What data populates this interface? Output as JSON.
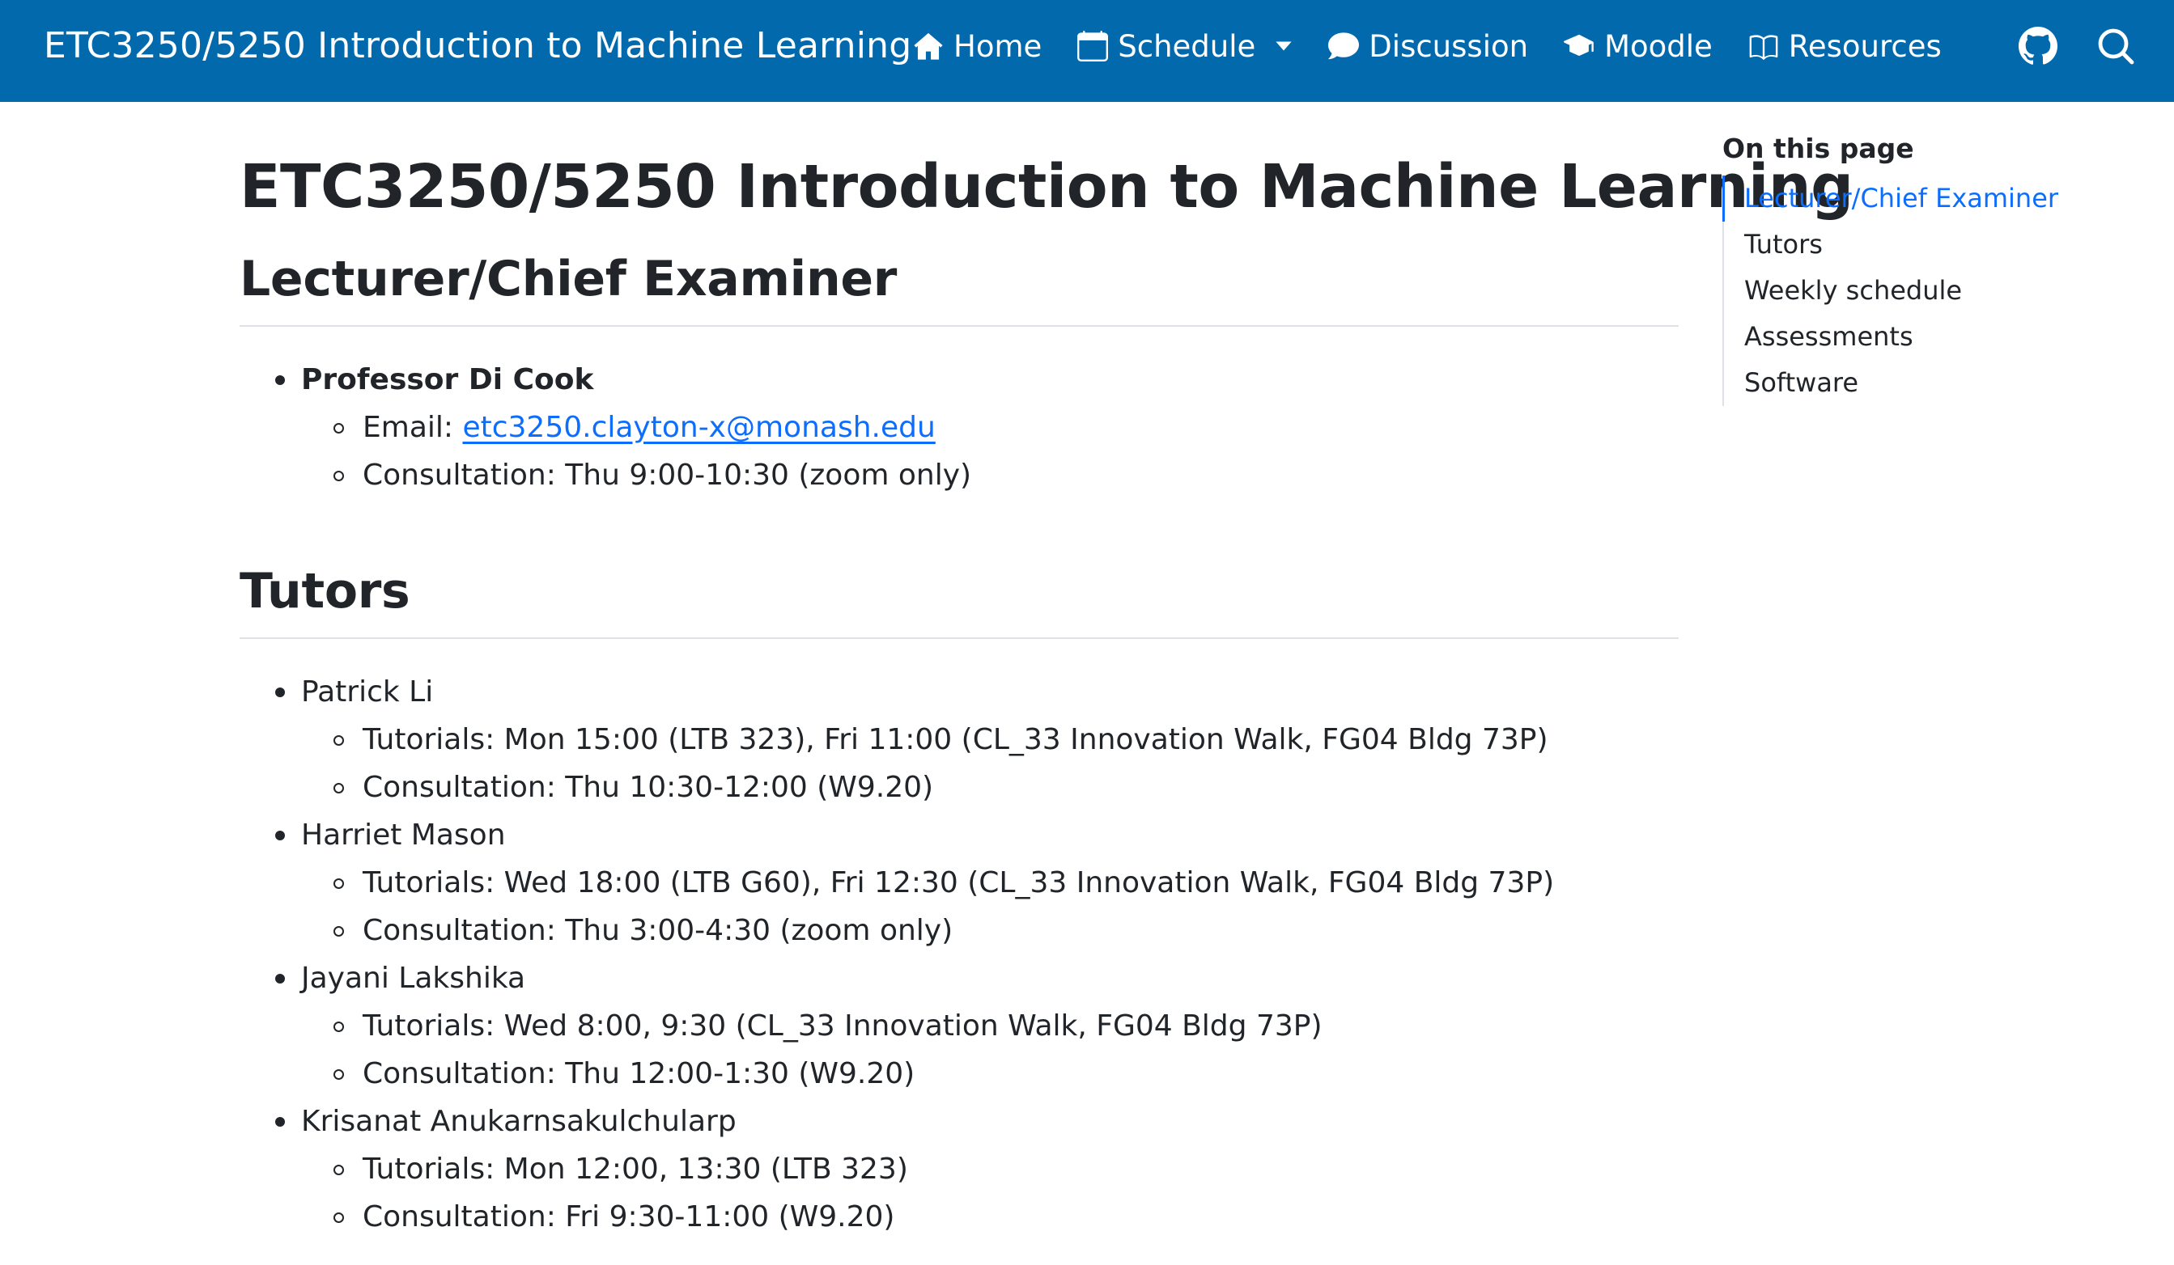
{
  "navbar": {
    "brand": "ETC3250/5250 Introduction to Machine Learning",
    "links": [
      {
        "label": "Home",
        "icon": "house-icon"
      },
      {
        "label": "Schedule",
        "icon": "calendar-icon",
        "dropdown": true
      },
      {
        "label": "Discussion",
        "icon": "chat-bubble-icon"
      },
      {
        "label": "Moodle",
        "icon": "mortarboard-icon"
      },
      {
        "label": "Resources",
        "icon": "open-book-icon"
      }
    ],
    "right_icons": [
      "github-icon",
      "search-icon"
    ],
    "background": "#0369ad"
  },
  "main": {
    "title": "ETC3250/5250 Introduction to Machine Learning",
    "lecturer_section": {
      "heading": "Lecturer/Chief Examiner",
      "name": "Professor Di Cook",
      "email_label": "Email: ",
      "email": "etc3250.clayton-x@monash.edu",
      "consultation": "Consultation: Thu 9:00-10:30 (zoom only)"
    },
    "tutors_section": {
      "heading": "Tutors",
      "tutors": [
        {
          "name": "Patrick Li",
          "tutorials": "Tutorials: Mon 15:00 (LTB 323), Fri 11:00 (CL_33 Innovation Walk, FG04 Bldg 73P)",
          "consultation": "Consultation: Thu 10:30-12:00 (W9.20)"
        },
        {
          "name": "Harriet Mason",
          "tutorials": "Tutorials: Wed 18:00 (LTB G60), Fri 12:30 (CL_33 Innovation Walk, FG04 Bldg 73P)",
          "consultation": "Consultation: Thu 3:00-4:30 (zoom only)"
        },
        {
          "name": "Jayani Lakshika",
          "tutorials": "Tutorials: Wed 8:00, 9:30 (CL_33 Innovation Walk, FG04 Bldg 73P)",
          "consultation": "Consultation: Thu 12:00-1:30 (W9.20)"
        },
        {
          "name": "Krisanat Anukarnsakulchularp",
          "tutorials": "Tutorials: Mon 12:00, 13:30 (LTB 323)",
          "consultation": "Consultation: Fri 9:30-11:00 (W9.20)"
        }
      ]
    }
  },
  "toc": {
    "title": "On this page",
    "items": [
      "Lecturer/Chief Examiner",
      "Tutors",
      "Weekly schedule",
      "Assessments",
      "Software"
    ],
    "active_index": 0
  },
  "colors": {
    "accent_link": "#0d6efd",
    "text": "#212529",
    "divider": "#dee2e6"
  }
}
